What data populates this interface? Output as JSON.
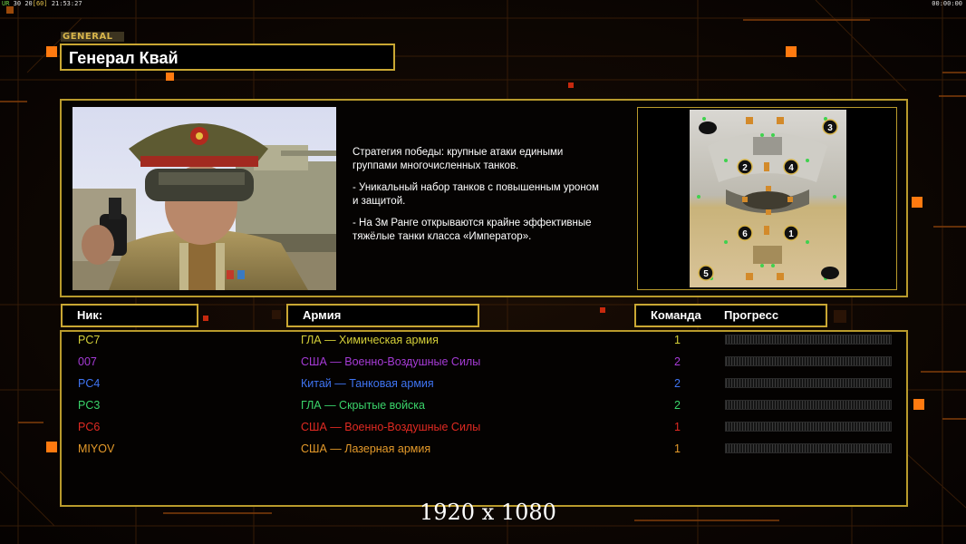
{
  "topbar": {
    "left_a": "UR",
    "left_b": "30",
    "left_c": "20",
    "left_d": "[60]",
    "left_time": "21:53:27",
    "right_time": "00:00:00"
  },
  "general": {
    "tag": "GENERAL",
    "name": "Генерал Квай"
  },
  "description": [
    "Стратегия победы: крупные атаки едиными\n группами многочисленных танков.",
    "- Уникальный набор танков с повышенным уроном\n  и защитой.",
    "- На 3м Ранге открываются крайне эффективные\n  тяжёлые танки класса «Император»."
  ],
  "map": {
    "spawns": [
      "1",
      "2",
      "3",
      "4",
      "5",
      "6"
    ]
  },
  "table": {
    "headers": {
      "nick": "Ник:",
      "army": "Армия",
      "team": "Команда",
      "progress": "Прогресс"
    },
    "rows": [
      {
        "nick": "PC7",
        "army": "ГЛА — Химическая армия",
        "team": "1",
        "color": "#d4cf38"
      },
      {
        "nick": "007",
        "army": "США — Военно-Воздушные Силы",
        "team": "2",
        "color": "#a63bd6"
      },
      {
        "nick": "PC4",
        "army": "Китай — Танковая армия",
        "team": "2",
        "color": "#3f74f2"
      },
      {
        "nick": "PC3",
        "army": "ГЛА — Скрытые войска",
        "team": "2",
        "color": "#3ad46a"
      },
      {
        "nick": "PC6",
        "army": "США — Военно-Воздушные Силы",
        "team": "1",
        "color": "#e02a22"
      },
      {
        "nick": "MIYOV",
        "army": "США — Лазерная армия",
        "team": "1",
        "color": "#e59a2a"
      }
    ]
  },
  "resolution_label": "1920 x 1080",
  "colors": {
    "frame": "#c9a733",
    "accent_orange": "#ff7a10"
  }
}
